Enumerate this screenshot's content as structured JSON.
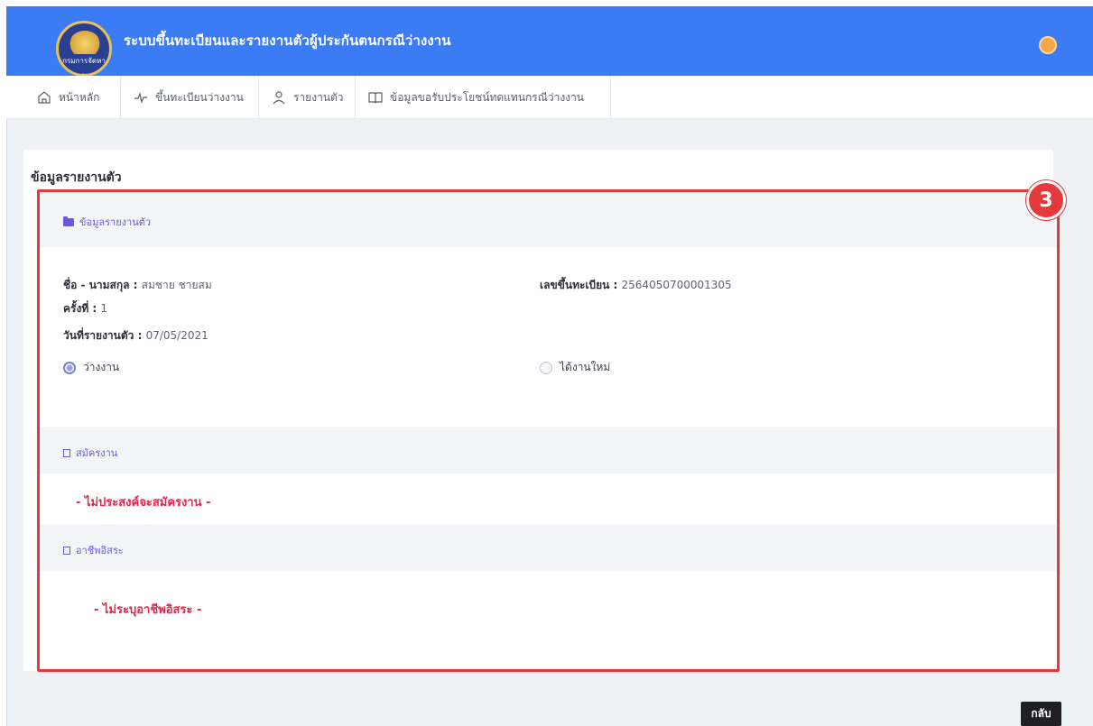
{
  "header": {
    "title": "ระบบขึ้นทะเบียนและรายงานตัวผู้ประกันตนกรณีว่างงาน",
    "logo_text": "กรมการจัดหางาน",
    "brand_color": "#3b7cf5"
  },
  "nav": {
    "items": [
      {
        "label": "หน้าหลัก",
        "icon": "home-icon"
      },
      {
        "label": "ขึ้นทะเบียนว่างงาน",
        "icon": "activity-icon"
      },
      {
        "label": "รายงานตัว",
        "icon": "user-icon"
      },
      {
        "label": "ข้อมูลขอรับประโยชน์ทดแทนกรณีว่างงาน",
        "icon": "book-icon"
      }
    ]
  },
  "page": {
    "title": "ข้อมูลรายงานตัว",
    "section_label": "ข้อมูลรายงานตัว"
  },
  "report": {
    "name_label": "ชื่อ - นามสกุล",
    "name_value": "สมชาย ชายสม",
    "reg_label": "เลขขึ้นทะเบียน",
    "reg_value": "2564050700001305",
    "round_label": "ครั้งที่",
    "round_value": "1",
    "date_label": "วันที่รายงานตัว",
    "date_value": "07/05/2021",
    "status_options": [
      {
        "label": "ว่างงาน",
        "selected": true
      },
      {
        "label": "ได้งานใหม่",
        "selected": false
      }
    ]
  },
  "apply_job": {
    "label": "สมัครงาน",
    "notice": "- ไม่ประสงค์จะสมัครงาน -"
  },
  "freelance": {
    "label": "อาชีพอิสระ",
    "notice": "- ไม่ระบุอาชีพอิสระ -"
  },
  "annotation": {
    "step_number": "3",
    "color": "#e5393c"
  },
  "actions": {
    "back_label": "กลับ"
  }
}
